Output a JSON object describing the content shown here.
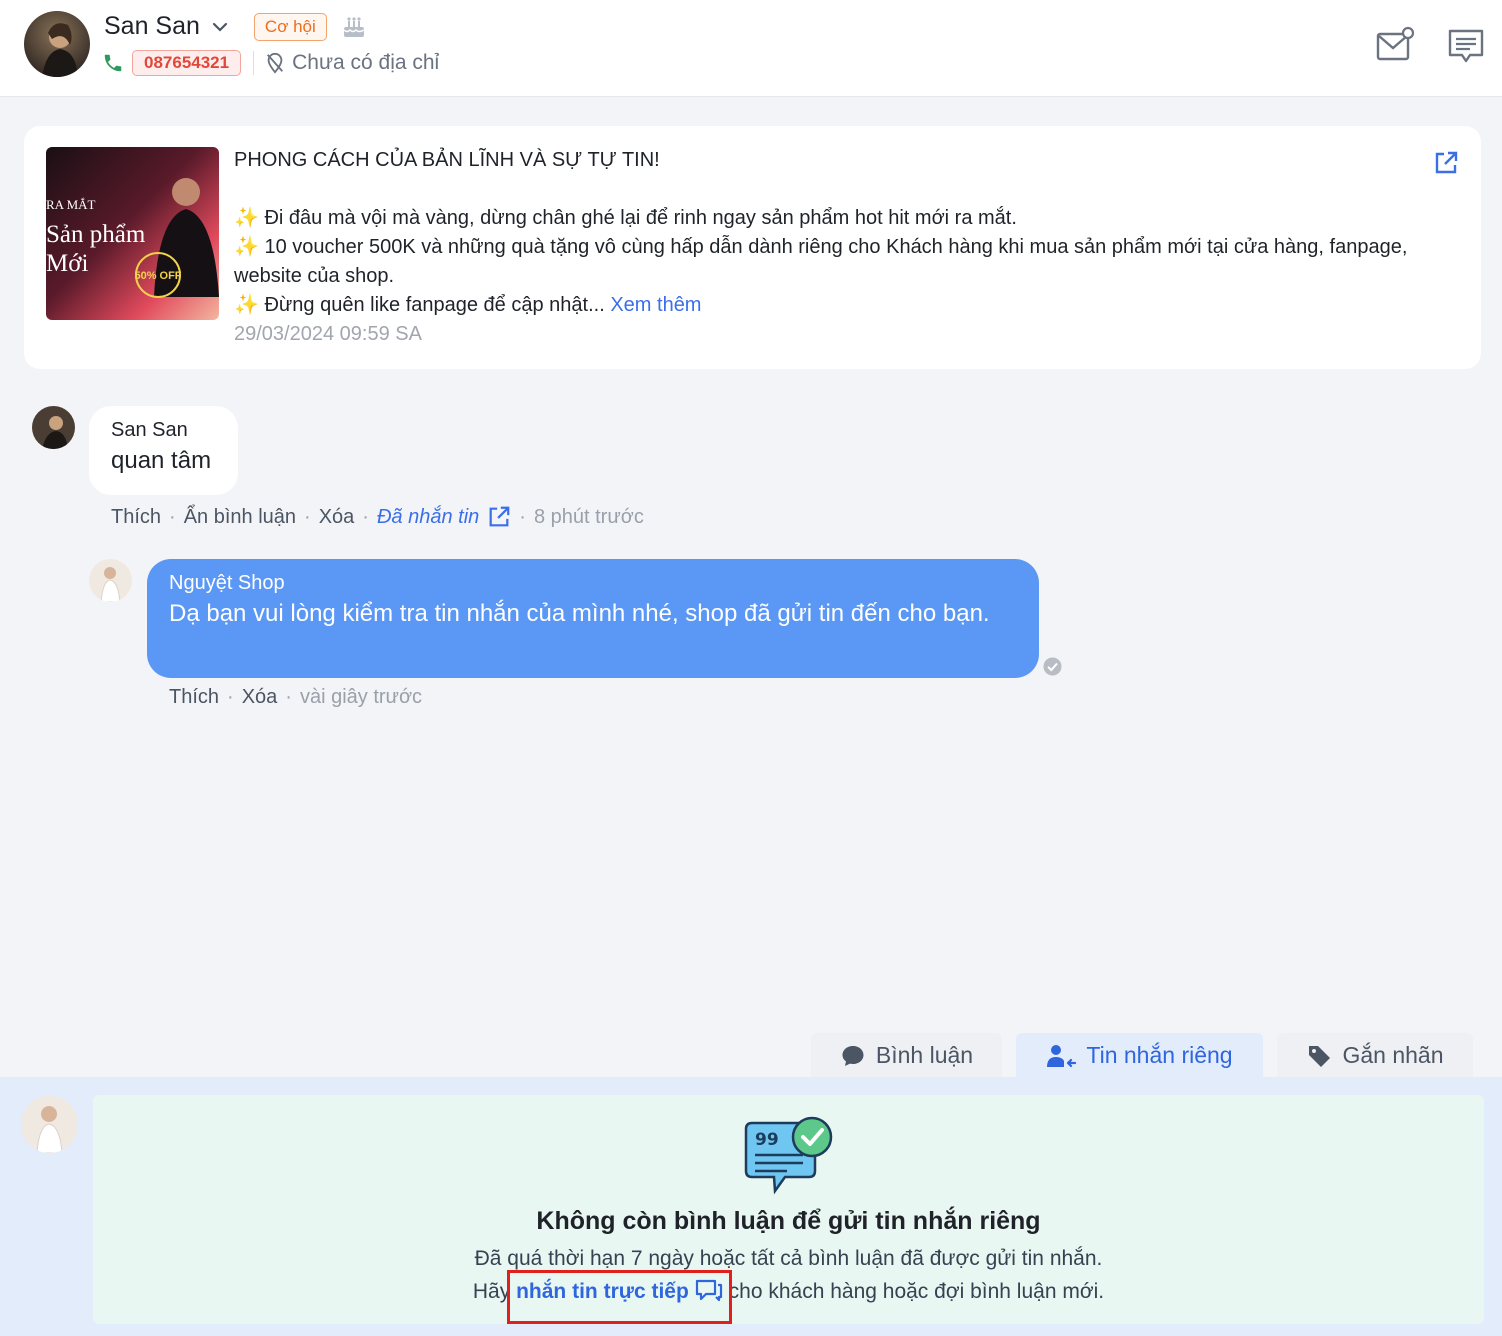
{
  "header": {
    "customer_name": "San San",
    "opportunity_badge": "Cơ hội",
    "phone": "087654321",
    "address": "Chưa có địa chỉ"
  },
  "post": {
    "thumb_line1": "RA MẮT",
    "thumb_line2": "Sản phẩm",
    "thumb_line3": "Mới",
    "thumb_sale": "50% OFF",
    "title": "PHONG CÁCH CỦA BẢN LĨNH VÀ SỰ TỰ TIN!",
    "line1": "✨ Đi đâu mà vội mà vàng, dừng chân ghé lại để rinh ngay sản phẩm hot hit mới ra mắt.",
    "line2": "✨ 10 voucher 500K và những quà tặng vô cùng hấp dẫn dành riêng cho Khách hàng khi mua sản phẩm mới tại cửa hàng, fanpage, website của shop.",
    "line3": "✨ Đừng quên like fanpage để cập nhật...",
    "see_more": "Xem thêm",
    "timestamp": "29/03/2024 09:59 SA"
  },
  "comment": {
    "author": "San San",
    "text": "quan tâm",
    "like": "Thích",
    "hide": "Ẩn bình luận",
    "delete": "Xóa",
    "messaged": "Đã nhắn tin",
    "time": "8 phút trước"
  },
  "reply": {
    "author": "Nguyệt Shop",
    "text": "Dạ bạn vui lòng kiểm tra tin nhắn của mình nhé, shop đã gửi tin đến cho bạn.",
    "like": "Thích",
    "delete": "Xóa",
    "time": "vài giây trước"
  },
  "tabs": {
    "comment": "Bình luận",
    "private": "Tin nhắn riêng",
    "tag": "Gắn nhãn"
  },
  "notice": {
    "title": "Không còn bình luận để gửi tin nhắn riêng",
    "line1": "Đã quá thời hạn 7 ngày hoặc tất cả bình luận đã được gửi tin nhắn.",
    "line2_prefix": "Hãy",
    "direct_link": "nhắn tin trực tiếp",
    "line2_suffix": "cho khách hàng hoặc đợi bình luận mới."
  },
  "colors": {
    "accent": "#2f66de",
    "bubble_blue": "#5b98f5",
    "highlight": "#e0201c"
  }
}
